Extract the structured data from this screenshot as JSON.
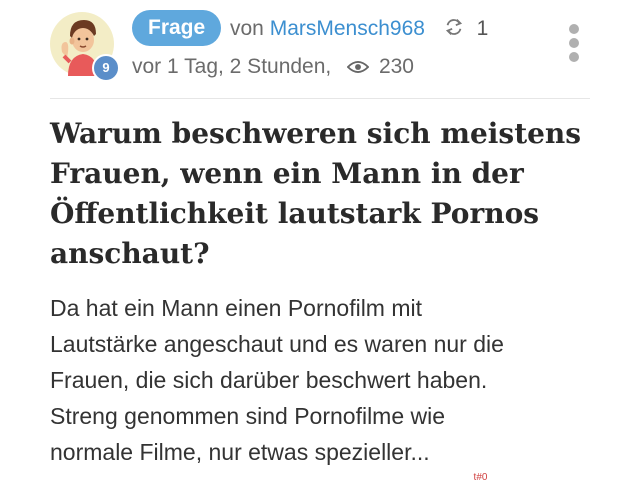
{
  "header": {
    "tag_label": "Frage",
    "by_label": "von",
    "username": "MarsMensch968",
    "share_count": "1",
    "time_ago": "vor 1 Tag, 2 Stunden,",
    "views": "230",
    "user_level": "9",
    "icons": {
      "share": "share-icon",
      "views": "eye-icon",
      "menu": "more-vertical-icon",
      "avatar": "user-avatar"
    }
  },
  "question": {
    "title_lines": [
      "Warum beschweren sich meistens",
      "Frauen, wenn ein Mann in der",
      "Öffentlichkeit lautstark Pornos",
      "anschaut?"
    ],
    "body_lines": [
      "Da hat ein Mann einen Pornofilm mit",
      "Lautstärke angeschaut und es waren nur die",
      "Frauen, die sich darüber beschwert haben.",
      "Streng genommen sind Pornofilme wie",
      "normale Filme, nur etwas spezieller..."
    ]
  },
  "watermark": "  t#0",
  "colors": {
    "accent_tag": "#5fa8dd",
    "username": "#3c8fd0",
    "level_badge": "#5b8ec9",
    "menu_dots": "#b0b0b0"
  }
}
